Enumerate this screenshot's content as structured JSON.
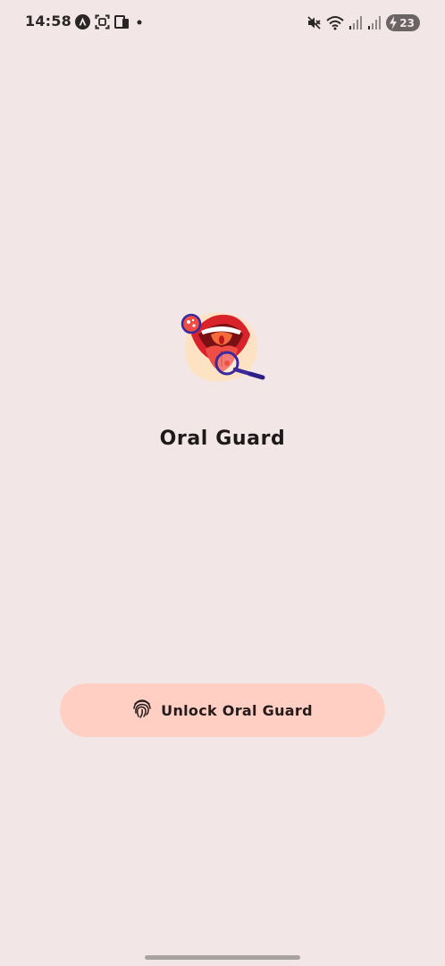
{
  "status_bar": {
    "time": "14:58",
    "battery_level": "23",
    "left_icons": [
      "android-auto-icon",
      "screenshot-icon",
      "device-icon",
      "notification-dot-icon"
    ],
    "right_icons": [
      "mute-icon",
      "wifi-icon",
      "signal-icon",
      "signal-icon-2",
      "battery-charging-icon"
    ]
  },
  "app": {
    "title": "Oral Guard",
    "logo_icon": "mouth-magnifier-logo"
  },
  "unlock": {
    "label": "Unlock Oral Guard",
    "icon": "fingerprint-icon"
  },
  "colors": {
    "background": "#f2e6e7",
    "button": "#ffcfc4",
    "text": "#1c1a1a"
  }
}
